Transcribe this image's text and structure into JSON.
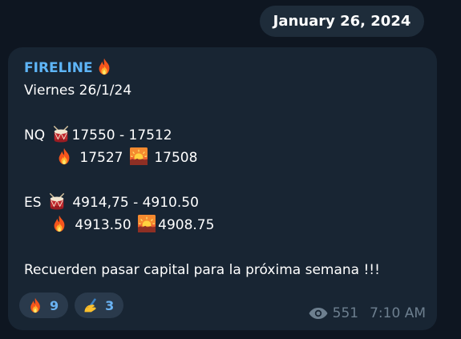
{
  "date_separator": "January 26, 2024",
  "message": {
    "sender": "FIRELINE",
    "sender_emoji": "fire-icon",
    "lines": {
      "day": "Viernes 26/1/24",
      "nq_label": "NQ",
      "nq_range": "17550 - 17512",
      "nq_fire_value": "17527",
      "nq_sunset_value": "17508",
      "es_label": "ES",
      "es_range": "4914,75 - 4910.50",
      "es_fire_value": "4913.50",
      "es_sunset_value": "4908.75",
      "note": "Recuerden pasar capital para la próxima semana !!!"
    },
    "reactions": [
      {
        "icon": "fire-icon",
        "count": "9"
      },
      {
        "icon": "writing-hand-icon",
        "count": "3"
      }
    ],
    "views": "551",
    "time": "7:10 AM"
  },
  "colors": {
    "background": "#0e1621",
    "bubble": "#182533",
    "sender": "#5eb5f7",
    "reaction_bg": "#2a3a4c",
    "reaction_count": "#6ab3f3",
    "meta": "#6d7f8f"
  }
}
